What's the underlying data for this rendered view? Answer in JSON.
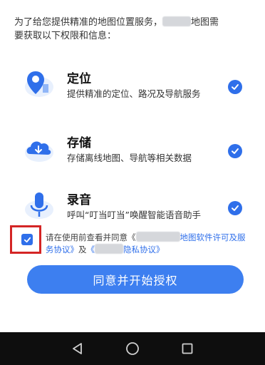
{
  "intro": {
    "line1_prefix": "为了给您提供精准的地图位置服务，",
    "line1_suffix": "地图需",
    "line2": "要获取以下权限和信息："
  },
  "permissions": [
    {
      "id": "location",
      "title": "定位",
      "desc": "提供精准的定位、路况及导航服务",
      "checked": true,
      "icon": "location-pin-icon"
    },
    {
      "id": "storage",
      "title": "存储",
      "desc": "存储离线地图、导航等相关数据",
      "checked": true,
      "icon": "cloud-download-icon"
    },
    {
      "id": "audio",
      "title": "录音",
      "desc": "呼叫“叮当叮当”唤醒智能语音助手",
      "checked": true,
      "icon": "microphone-icon"
    }
  ],
  "agreement": {
    "checked": true,
    "text_prefix": "请在使用前查看并同意《",
    "link1_suffix": "地图软件许可及服务协议》",
    "and": "及",
    "link2_prefix": "《",
    "link2_suffix": "隐私协议》"
  },
  "cta_label": "同意并开始授权",
  "nav": {
    "back_icon": "back-triangle-icon",
    "home_icon": "home-circle-icon",
    "recents_icon": "recents-square-icon"
  },
  "colors": {
    "accent": "#2f6fea",
    "button": "#3d7ff0",
    "highlight_border": "#d42525",
    "navbar": "#0e0e0e"
  }
}
